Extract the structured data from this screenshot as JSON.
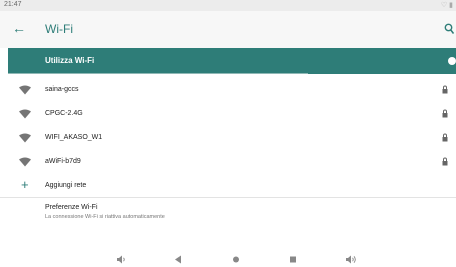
{
  "status_bar": {
    "time": "21:47",
    "indicators": "♡ ▮"
  },
  "app_bar": {
    "back_icon": "arrow-left-icon",
    "title": "Wi-Fi",
    "search_icon": "search-icon"
  },
  "master_switch": {
    "label": "Utilizza Wi-Fi",
    "enabled": true
  },
  "networks": [
    {
      "ssid": "saina-gccs",
      "secured": true
    },
    {
      "ssid": "CPGC-2.4G",
      "secured": true
    },
    {
      "ssid": "WIFI_AKASO_W1",
      "secured": true
    },
    {
      "ssid": "aWiFi-b7d9",
      "secured": true
    }
  ],
  "add_network": {
    "label": "Aggiungi rete"
  },
  "preferences": {
    "title": "Preferenze Wi-Fi",
    "subtitle": "La connessione Wi-Fi si riattiva automaticamente"
  },
  "nav_bar": {
    "items": [
      "volume-down-icon",
      "back-icon",
      "home-icon",
      "recents-icon",
      "volume-up-icon"
    ]
  },
  "colors": {
    "accent": "#2e7d78",
    "wifi_icon": "#757575"
  }
}
